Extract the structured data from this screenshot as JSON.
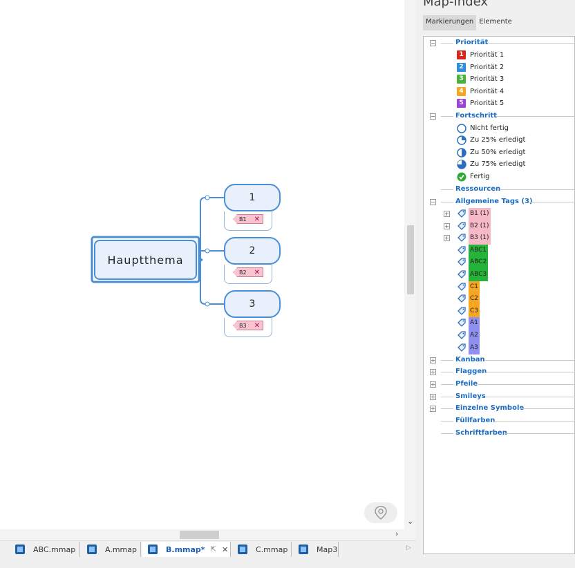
{
  "mindmap": {
    "central_topic": "Hauptthema",
    "topics": [
      {
        "label": "1",
        "tag": "B1",
        "remove_glyph": "✕"
      },
      {
        "label": "2",
        "tag": "B2",
        "remove_glyph": "✕"
      },
      {
        "label": "3",
        "tag": "B3",
        "remove_glyph": "✕"
      }
    ]
  },
  "scroll": {
    "down_arrow": "⌄",
    "right_arrow": "›"
  },
  "document_tabs": [
    {
      "label": "ABC.mmap"
    },
    {
      "label": "A.mmap"
    },
    {
      "label": "B.mmap*",
      "pin_glyph": "⇱",
      "close_glyph": "✕"
    },
    {
      "label": "C.mmap"
    },
    {
      "label": "Map3"
    }
  ],
  "tab_overflow_glyph": "▷",
  "panel": {
    "title": "Map-Index",
    "tabs": [
      "Markierungen",
      "Elemente"
    ],
    "expand_minus": "−",
    "expand_plus": "+",
    "groups": {
      "prioritaet": "Priorität",
      "fortschritt": "Fortschritt",
      "ressourcen": "Ressourcen",
      "allgemeine": "Allgemeine Tags (3)",
      "kanban": "Kanban",
      "flaggen": "Flaggen",
      "pfeile": "Pfeile",
      "smileys": "Smileys",
      "einzelne": "Einzelne Symbole",
      "fuellfarben": "Füllfarben",
      "schriftfarben": "Schriftfarben"
    },
    "priorities": [
      {
        "num": "1",
        "label": "Priorität 1",
        "color": "#d9261c"
      },
      {
        "num": "2",
        "label": "Priorität 2",
        "color": "#2b8fe0"
      },
      {
        "num": "3",
        "label": "Priorität 3",
        "color": "#48b53a"
      },
      {
        "num": "4",
        "label": "Priorität 4",
        "color": "#f5a623"
      },
      {
        "num": "5",
        "label": "Priorität 5",
        "color": "#9b45d8"
      }
    ],
    "progress": [
      {
        "label": "Nicht fertig",
        "icon": "progress-0-icon"
      },
      {
        "label": "Zu 25% erledigt",
        "icon": "progress-25-icon"
      },
      {
        "label": "Zu 50% erledigt",
        "icon": "progress-50-icon"
      },
      {
        "label": "Zu 75% erledigt",
        "icon": "progress-75-icon"
      },
      {
        "label": "Fertig",
        "icon": "check-icon"
      }
    ],
    "tags": [
      {
        "label": "B1 (1)",
        "color": "#f5b9c8",
        "expandable": true
      },
      {
        "label": "B2 (1)",
        "color": "#f5b9c8",
        "expandable": true
      },
      {
        "label": "B3 (1)",
        "color": "#f5b9c8",
        "expandable": true
      },
      {
        "label": "ABC1",
        "color": "#25b33a"
      },
      {
        "label": "ABC2",
        "color": "#25b33a"
      },
      {
        "label": "ABC3",
        "color": "#25b33a"
      },
      {
        "label": "C1",
        "color": "#f5a623"
      },
      {
        "label": "C2",
        "color": "#f5a623"
      },
      {
        "label": "C3",
        "color": "#f5a623"
      },
      {
        "label": "A1",
        "color": "#8f8ff0"
      },
      {
        "label": "A2",
        "color": "#8f8ff0"
      },
      {
        "label": "A3",
        "color": "#8f8ff0"
      }
    ]
  }
}
